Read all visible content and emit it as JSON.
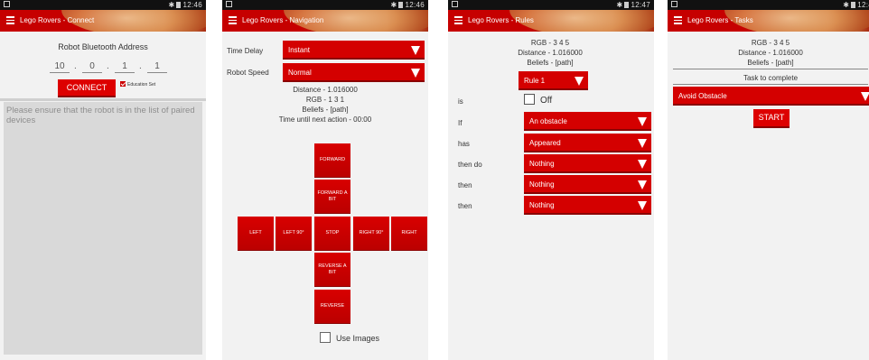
{
  "status": {
    "time1": "12:46",
    "time2": "12:46",
    "time3": "12:47",
    "time4": "12:4"
  },
  "screens": {
    "connect": {
      "title": "Lego Rovers - Connect",
      "bt_label": "Robot Bluetooth Address",
      "ip": [
        "10",
        "0",
        "1",
        "1"
      ],
      "connect_label": "CONNECT",
      "education_label": "Education Set",
      "message": "Please ensure that the robot is in the list of paired devices"
    },
    "navigation": {
      "title": "Lego Rovers - Navigation",
      "time_delay_label": "Time Delay",
      "time_delay_value": "Instant",
      "robot_speed_label": "Robot Speed",
      "robot_speed_value": "Normal",
      "distance": "Distance - 1.016000",
      "rgb": "RGB - 1 3 1",
      "beliefs": "Beliefs - [path]",
      "time_until": "Time until next action - 00:00",
      "buttons": {
        "forward": "FORWARD",
        "forward_bit": "FORWARD A BIT",
        "left": "LEFT",
        "left90": "LEFT 90°",
        "stop": "STOP",
        "right90": "RIGHT 90°",
        "right": "RIGHT",
        "reverse_bit": "REVERSE A BIT",
        "reverse": "REVERSE"
      },
      "use_images": "Use Images"
    },
    "rules": {
      "title": "Lego Rovers - Rules",
      "rgb": "RGB - 3 4 5",
      "distance": "Distance - 1.016000",
      "beliefs": "Beliefs - [path]",
      "rule_select": "Rule 1",
      "rows": [
        {
          "label": "is",
          "value": "Off"
        },
        {
          "label": "If",
          "value": "An obstacle"
        },
        {
          "label": "has",
          "value": "Appeared"
        },
        {
          "label": "then do",
          "value": "Nothing"
        },
        {
          "label": "then",
          "value": "Nothing"
        },
        {
          "label": "then",
          "value": "Nothing"
        }
      ]
    },
    "tasks": {
      "title": "Lego Rovers - Tasks",
      "rgb": "RGB - 3 4 5",
      "distance": "Distance - 1.016000",
      "beliefs": "Beliefs - [path]",
      "task_label": "Task to complete",
      "task_value": "Avoid Obstacle",
      "start_label": "START"
    }
  },
  "colors": {
    "accent": "#d40000",
    "panel": "#d9d9d9",
    "statusbar": "#111111"
  }
}
